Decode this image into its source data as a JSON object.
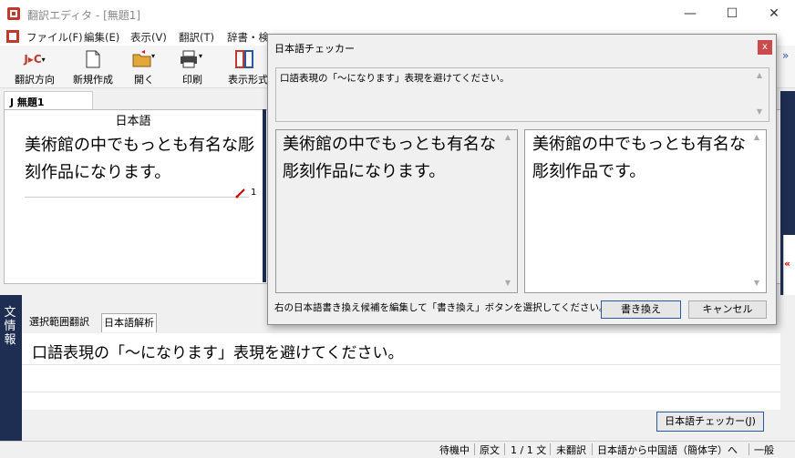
{
  "window": {
    "title": "翻訳エディタ - [無題1]",
    "minimize_glyph": "—",
    "maximize_glyph": "☐",
    "close_glyph": "✕"
  },
  "menu": [
    "ファイル(F)",
    "編集(E)",
    "表示(V)",
    "翻訳(T)",
    "辞書・検"
  ],
  "toolbar": {
    "direction_label": "翻訳方向",
    "direction_glyph": "J▸C",
    "new_label": "新規作成",
    "open_label": "開く",
    "print_label": "印刷",
    "display_label": "表示形式",
    "overflow_glyph": "»"
  },
  "document": {
    "tab_label": "J 無題1",
    "source_header": "日本語",
    "source_text": "美術館の中でもっとも有名な彫刻作品になります。",
    "line_number": "1"
  },
  "info_panel": {
    "sidebar_label": "文情報",
    "tabs": [
      "選択範囲翻訳",
      "日本語解析"
    ],
    "message": "口語表現の「〜になります」表現を避けてください。",
    "checker_button": "日本語チェッカー(J)",
    "collapse_glyph": "«"
  },
  "status_bar": {
    "state": "待機中",
    "mode": "原文",
    "position": "1 / 1 文",
    "translation_status": "未翻訳",
    "direction": "日本語から中国語（簡体字）へ",
    "field": "一般"
  },
  "dialog": {
    "title": "日本語チェッカー",
    "close_glyph": "x",
    "message": "口語表現の「〜になります」表現を避けてください。",
    "original_text": "美術館の中でもっとも有名な彫刻作品になります。",
    "candidate_text": "美術館の中でもっとも有名な彫刻作品です。",
    "instruction": "右の日本語書き換え候補を編集して「書き換え」ボタンを選択してください。",
    "rewrite_button": "書き換え",
    "cancel_button": "キャンセル"
  },
  "colors": {
    "accent_dark": "#1e2d52",
    "app_icon_red": "#c0392b",
    "dialog_close": "#c94b4b"
  }
}
